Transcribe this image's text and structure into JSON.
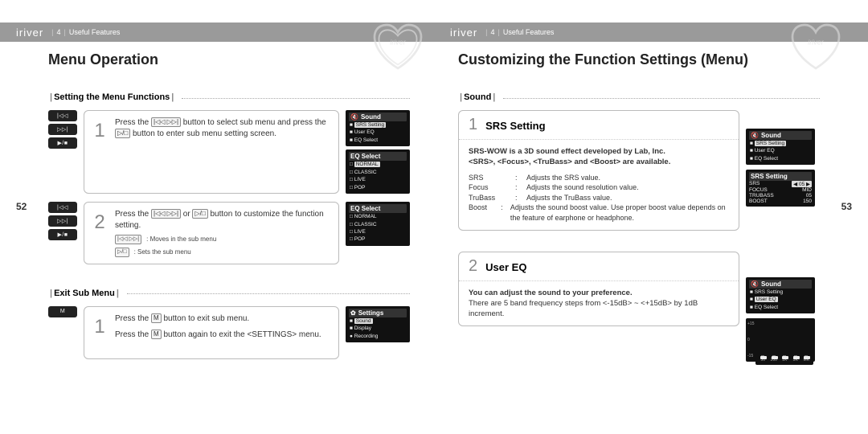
{
  "brand": "iriver",
  "breadcrumb_section": "4",
  "breadcrumb_label": "Useful Features",
  "left": {
    "pagenum": "52",
    "title": "Menu Operation",
    "sec1": {
      "heading": "Setting the Menu Functions",
      "step1": {
        "num": "1",
        "text_a": "Press the ",
        "btn1": "|◁◁ ▷▷|",
        "text_b": " button to select sub menu and press the ",
        "btn2": "▷/□",
        "text_c": " button to enter sub menu setting screen."
      },
      "step2": {
        "num": "2",
        "text_a": "Press the ",
        "btn1": "|◁◁ ▷▷|",
        "text_b": " or ",
        "btn2": "▷/□",
        "text_c": " button to customize the function setting.",
        "hint1_btn": "|◁◁ ▷▷|",
        "hint1_txt": ": Moves in the sub menu",
        "hint2_btn": "▷/□",
        "hint2_txt": ": Sets the sub menu"
      }
    },
    "sec2": {
      "heading": "Exit Sub Menu",
      "step1": {
        "num": "1",
        "line1_a": "Press the ",
        "line1_btn": "M",
        "line1_b": " button to exit sub menu.",
        "line2_a": "Press the ",
        "line2_btn": "M",
        "line2_b": " button again to exit the <SETTINGS> menu."
      }
    },
    "hwbtns": {
      "prev": "|◁◁",
      "next": "▷▷|",
      "play": "▶/■",
      "m": "M"
    },
    "lcd": {
      "sound_hdr": "Sound",
      "sound_items": [
        "SRS Setting",
        "User EQ",
        "EQ Select"
      ],
      "eqsel_hdr": "EQ Select",
      "eqsel_items": [
        "NORMAL",
        "CLASSIC",
        "LIVE",
        "POP"
      ],
      "settings_hdr": "Settings",
      "settings_items": [
        "Sound",
        "Display",
        "Recording"
      ]
    }
  },
  "right": {
    "pagenum": "53",
    "title": "Customizing the Function Settings (Menu)",
    "sec": {
      "heading": "Sound"
    },
    "srs": {
      "num": "1",
      "name": "SRS Setting",
      "bold1": "SRS-WOW is a 3D sound effect developed by Lab, Inc.",
      "bold2": "<SRS>, <Focus>, <TruBass> and <Boost> are available.",
      "params": [
        {
          "name": "SRS",
          "desc": "Adjusts the SRS value."
        },
        {
          "name": "Focus",
          "desc": "Adjusts the sound resolution value."
        },
        {
          "name": "TruBass",
          "desc": "Adjusts the TruBass value."
        },
        {
          "name": "Boost",
          "desc": "Adjusts the sound boost value. Use proper boost value depends on the feature of earphone or headphone."
        }
      ]
    },
    "usereq": {
      "num": "2",
      "name": "User EQ",
      "bold": "You can adjust the sound to your preference.",
      "desc": "There are 5 band frequency steps from <-15dB> ~ <+15dB> by 1dB increment."
    },
    "lcd": {
      "sound_hdr": "Sound",
      "sound_items": [
        "SRS Setting",
        "User EQ",
        "EQ Select"
      ],
      "srs_hdr": "SRS Setting",
      "srs_rows": [
        {
          "k": "SRS",
          "v": "◀ 05 ▶"
        },
        {
          "k": "FOCUS",
          "v": "MID"
        },
        {
          "k": "TRUBASS",
          "v": "05"
        },
        {
          "k": "BOOST",
          "v": "150"
        }
      ],
      "eq_bands": [
        "50",
        "200",
        "1K",
        "5K",
        "MK"
      ],
      "eq_scale_top": "+15",
      "eq_scale_mid": "0",
      "eq_scale_bot": "-15"
    }
  }
}
